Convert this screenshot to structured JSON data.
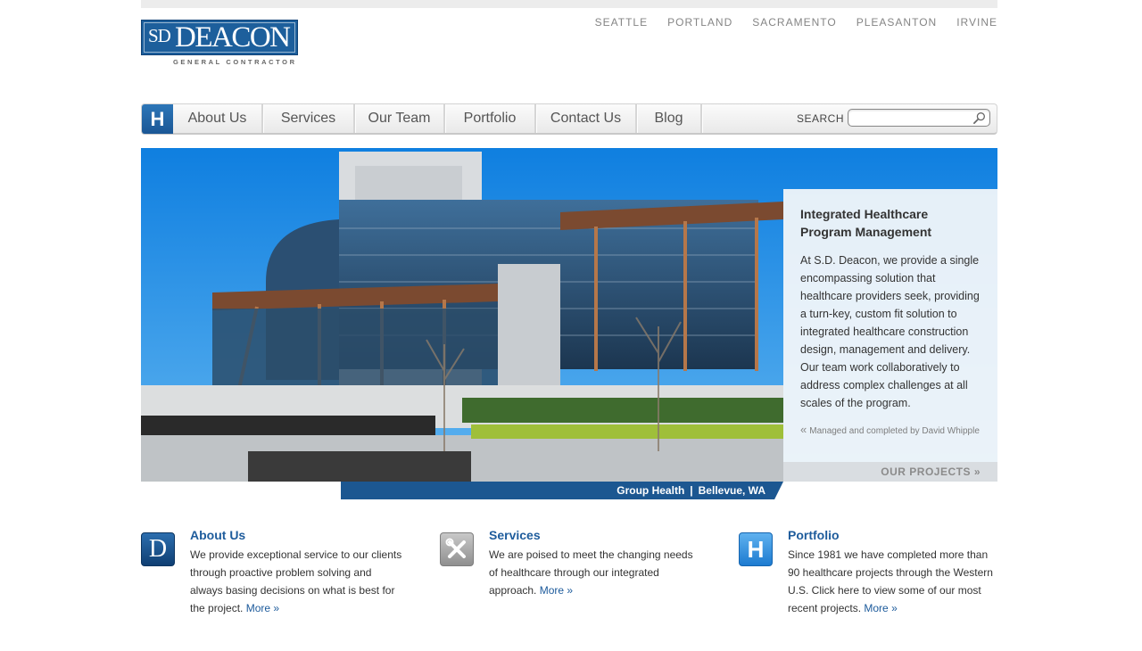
{
  "logo": {
    "sd": "SD",
    "name": "DEACON",
    "tagline": "GENERAL CONTRACTOR"
  },
  "cities": [
    "SEATTLE",
    "PORTLAND",
    "SACRAMENTO",
    "PLEASANTON",
    "IRVINE"
  ],
  "nav": {
    "home_icon_label": "H",
    "items": [
      "About Us",
      "Services",
      "Our Team",
      "Portfolio",
      "Contact Us",
      "Blog"
    ],
    "search_label": "SEARCH",
    "search_value": ""
  },
  "hero": {
    "title": "Integrated Healthcare Program Management",
    "text": "At S.D. Deacon, we provide a single encompassing solution that healthcare providers seek, providing a turn-key, custom fit solution to integrated healthcare construction design, management and delivery. Our team work collaboratively to address complex challenges at all scales of the program.",
    "credit_prefix": "«",
    "credit": "Managed and completed by David Whipple",
    "projects_link": "OUR PROJECTS »",
    "caption_project": "Group Health",
    "caption_sep": "|",
    "caption_location": "Bellevue, WA"
  },
  "features": [
    {
      "icon": "deacon-d-icon",
      "icon_glyph": "D",
      "title": "About Us",
      "text": "We provide exceptional service to our clients through proactive problem solving and always basing decisions on what is best for the project.",
      "more": "More »"
    },
    {
      "icon": "tools-icon",
      "title": "Services",
      "text": "We are poised to meet the changing needs of healthcare through our integrated approach.",
      "more": "More »"
    },
    {
      "icon": "healthcare-h-icon",
      "icon_glyph": "H",
      "title": "Portfolio",
      "text": "Since 1981 we have completed more than 90 healthcare projects through the Western U.S. Click here to view some of our most recent projects.",
      "more": "More »"
    }
  ],
  "colors": {
    "brand_blue": "#1d5f9c",
    "link_blue": "#1c5a9b",
    "caption_bar": "#1c5791",
    "sky": "#1e90e2"
  }
}
